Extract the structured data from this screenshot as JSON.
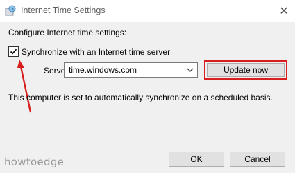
{
  "window": {
    "title": "Internet Time Settings",
    "icon": "clock-globe-icon",
    "close_icon": "✕"
  },
  "dialog": {
    "heading": "Configure Internet time settings:",
    "sync_checkbox": {
      "label": "Synchronize with an Internet time server",
      "checked": true
    },
    "server": {
      "label": "Server:",
      "value": "time.windows.com"
    },
    "update_button": "Update now",
    "info": "This computer is set to automatically synchronize on a scheduled basis.",
    "ok_button": "OK",
    "cancel_button": "Cancel"
  },
  "annotation": {
    "highlight_color": "#d81e1e"
  },
  "watermark": "howtoedge"
}
